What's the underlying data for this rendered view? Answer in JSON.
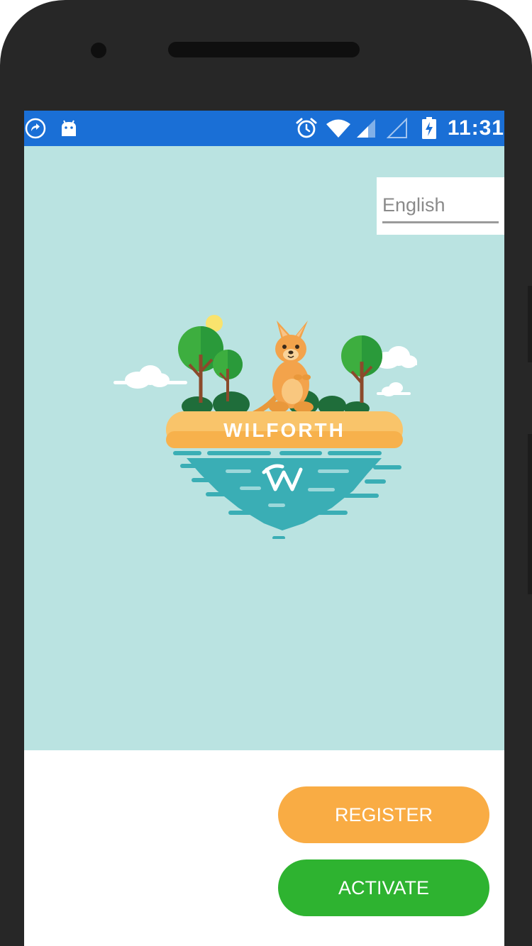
{
  "status_bar": {
    "time": "11:31",
    "icons": [
      "call-forward-icon",
      "android-icon",
      "alarm-icon",
      "wifi-icon",
      "signal-icon",
      "signal-empty-icon",
      "battery-charging-icon"
    ],
    "background_color": "#1a6fd6"
  },
  "language_select": {
    "value": "English"
  },
  "logo": {
    "wordmark": "WILFORTH",
    "monogram": "W"
  },
  "actions": {
    "register_label": "REGISTER",
    "activate_label": "ACTIVATE"
  },
  "colors": {
    "hero_background": "#bae3e1",
    "register": "#f9ac44",
    "activate": "#2eb330",
    "sand": "#f9c46a",
    "water": "#3aaeb5"
  }
}
